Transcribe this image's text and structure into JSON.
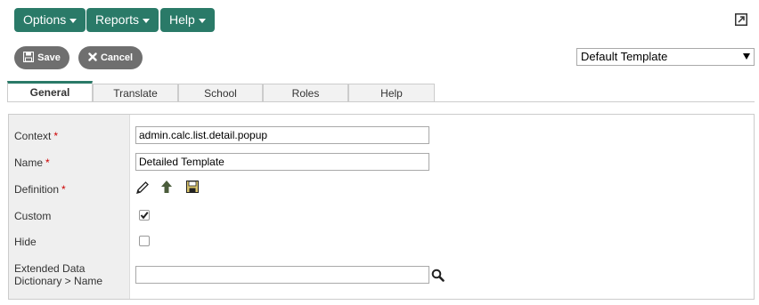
{
  "menu": {
    "options_label": "Options",
    "reports_label": "Reports",
    "help_label": "Help"
  },
  "toolbar": {
    "save_label": "Save",
    "cancel_label": "Cancel"
  },
  "template_select": {
    "selected": "Default Template"
  },
  "tabs": [
    {
      "label": "General",
      "active": true
    },
    {
      "label": "Translate",
      "active": false
    },
    {
      "label": "School",
      "active": false
    },
    {
      "label": "Roles",
      "active": false
    },
    {
      "label": "Help",
      "active": false
    }
  ],
  "form": {
    "context": {
      "label": "Context",
      "value": "admin.calc.list.detail.popup",
      "required": "*"
    },
    "name": {
      "label": "Name",
      "value": "Detailed Template",
      "required": "*"
    },
    "definition": {
      "label": "Definition",
      "required": "*"
    },
    "custom": {
      "label": "Custom",
      "checked": true
    },
    "hide": {
      "label": "Hide",
      "checked": false
    },
    "extended": {
      "label_line1": "Extended Data",
      "label_line2": "Dictionary > Name",
      "value": ""
    }
  },
  "colors": {
    "accent": "#2a7a68",
    "action_button": "#6f6f6f",
    "required": "#cc0000"
  }
}
